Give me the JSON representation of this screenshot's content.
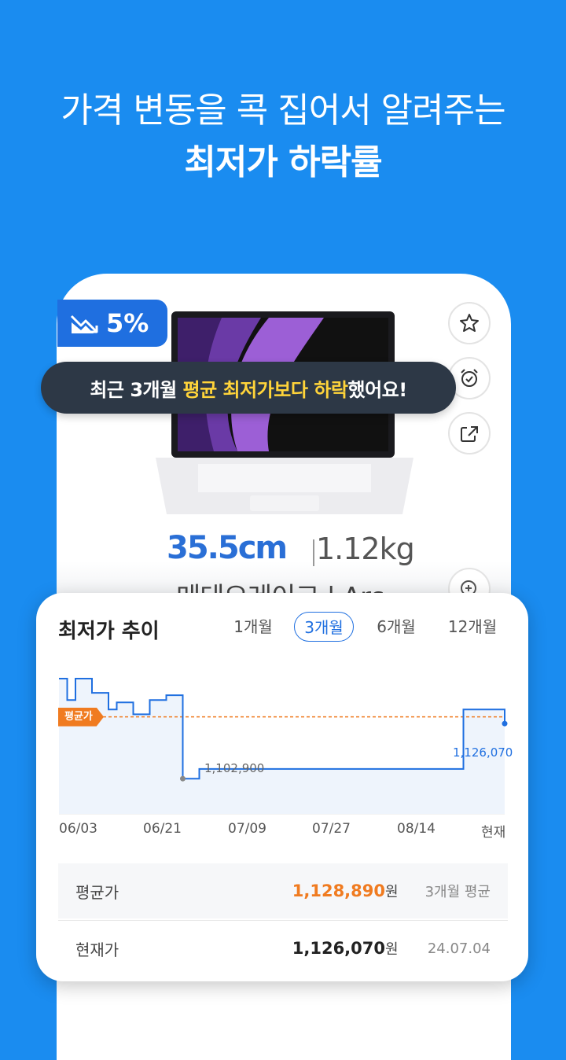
{
  "headline": {
    "line1": "가격 변동을 콕 집어서 알려주는",
    "line2": "최저가 하락률"
  },
  "product": {
    "size_text": "35.5cm",
    "weight_text": "1.12kg",
    "name_text": "메테오레이크 | Arc"
  },
  "badge": {
    "drop_icon": "trend-down-icon",
    "percent": "5%"
  },
  "tooltip": {
    "prefix": "최근 3개월 ",
    "highlight": "평균 최저가보다 하락",
    "suffix": "했어요!"
  },
  "actions": [
    "star-icon",
    "alarm-icon",
    "share-icon",
    "zoom-plus-icon"
  ],
  "card": {
    "title": "최저가 추이",
    "tabs": [
      "1개월",
      "3개월",
      "6개월",
      "12개월"
    ],
    "active_tab": "3개월",
    "avg_tag": "평균가",
    "min_label": "1,102,900",
    "current_label": "1,126,070",
    "x_labels": [
      "06/03",
      "06/21",
      "07/09",
      "07/27",
      "08/14",
      "현재"
    ],
    "rows": [
      {
        "label": "평균가",
        "value": "1,128,890",
        "unit": "원",
        "note": "3개월 평균"
      },
      {
        "label": "현재가",
        "value": "1,126,070",
        "unit": "원",
        "note": "24.07.04"
      }
    ]
  },
  "colors": {
    "background": "#1a8cf0",
    "accent_blue": "#1f6fe0",
    "avg_orange": "#f07b20",
    "tooltip_bg": "#2d3846",
    "tooltip_highlight": "#ffd43a"
  },
  "chart_data": {
    "type": "line",
    "x": [
      "06/03",
      "06/21",
      "07/09",
      "07/27",
      "08/14",
      "현재"
    ],
    "average": 1128890,
    "series": [
      {
        "values": [
          1145000,
          1136000,
          1145000,
          1145000,
          1139000,
          1139000,
          1132000,
          1135000,
          1135000,
          1130000,
          1130000,
          1136000,
          1136000,
          1138000,
          1138000,
          1102900,
          1102900,
          1107000,
          1107000,
          1107000,
          1107000,
          1107000,
          1107000,
          1107000,
          1107000,
          1107000,
          1107000,
          1107000,
          1107000,
          1107000,
          1107000,
          1107000,
          1107000,
          1107000,
          1107000,
          1107000,
          1107000,
          1107000,
          1107000,
          1107000,
          1107000,
          1107000,
          1107000,
          1107000,
          1107000,
          1107000,
          1107000,
          1107000,
          1107000,
          1132000,
          1132000,
          1132000,
          1132000,
          1132000,
          1126070
        ]
      }
    ],
    "min_point_label": "1,102,900",
    "current_point_label": "1,126,070"
  }
}
